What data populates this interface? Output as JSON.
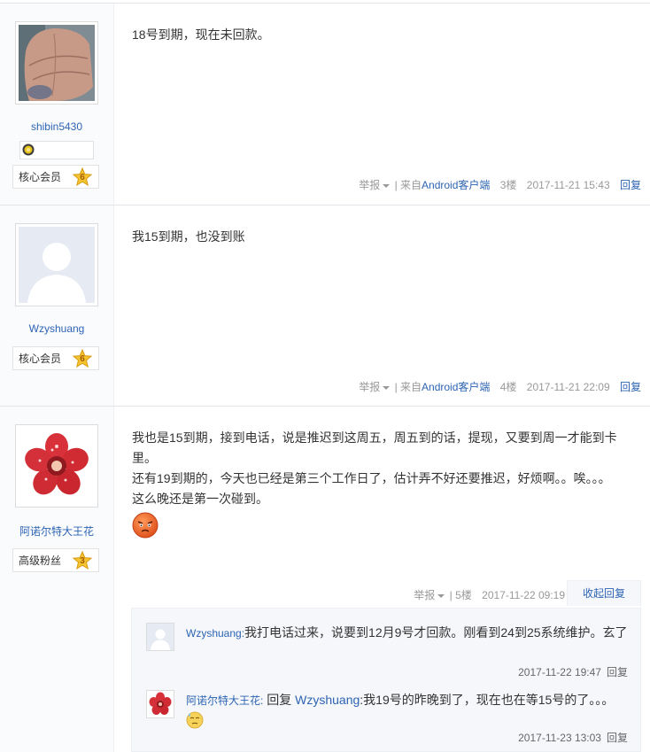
{
  "posts": [
    {
      "username": "shibin5430",
      "rank_title": "核心会员",
      "rank_level": "6",
      "body": [
        "18号到期，现在未回款。"
      ],
      "meta": {
        "report": "举报",
        "source": "| 来自",
        "client": "Android客户端",
        "floor": "3楼",
        "time": "2017-11-21 15:43",
        "reply": "回复"
      }
    },
    {
      "username": "Wzyshuang",
      "rank_title": "核心会员",
      "rank_level": "6",
      "body": [
        "我15到期，也没到账"
      ],
      "meta": {
        "report": "举报",
        "source": "| 来自",
        "client": "Android客户端",
        "floor": "4楼",
        "time": "2017-11-21 22:09",
        "reply": "回复"
      }
    },
    {
      "username": "阿诺尔特大王花",
      "rank_title": "高级粉丝",
      "rank_level": "3",
      "body": [
        "我也是15到期，接到电话，说是推迟到这周五，周五到的话，提现，又要到周一才能到卡里。",
        "还有19到期的，今天也已经是第三个工作日了，估计弄不好还要推迟，好烦啊。。唉。。。",
        "这么晚还是第一次碰到。"
      ],
      "meta": {
        "report": "举报",
        "floor": "| 5楼",
        "time": "2017-11-22 09:19",
        "collapse": "收起回复"
      }
    }
  ],
  "sub_replies": [
    {
      "author": "Wzyshuang:",
      "text": "我打电话过来，说要到12月9号才回款。刚看到24到25系统维护。玄了",
      "time": "2017-11-22 19:47",
      "reply": "回复"
    },
    {
      "author": "阿诺尔特大王花:",
      "reply_prefix": "回复",
      "reply_to": "Wzyshuang",
      "text": ":我19号的昨晚到了，现在也在等15号的了。。。",
      "time": "2017-11-23 13:03",
      "reply": "回复"
    }
  ],
  "colors": {
    "link": "#2d64b3",
    "meta": "#999999",
    "sidebar_bg": "#fafbfc",
    "lzl_bg": "#f5f7fa"
  }
}
